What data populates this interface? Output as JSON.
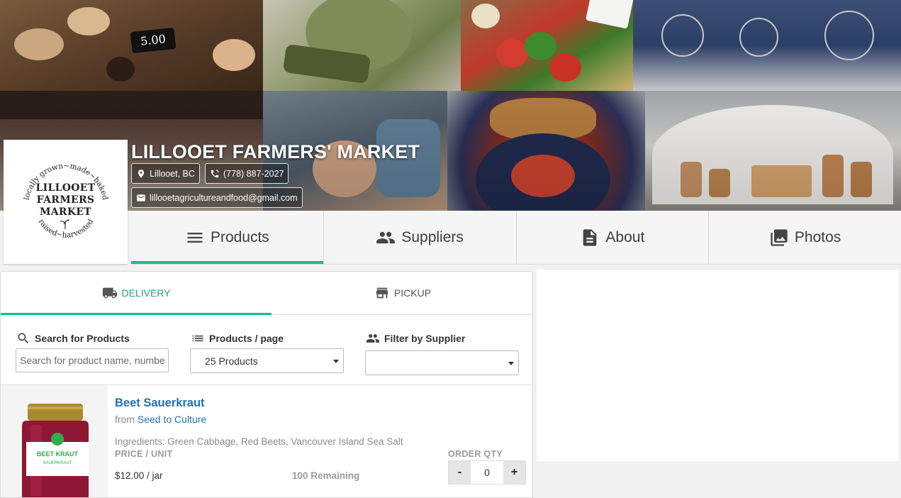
{
  "market": {
    "name": "LILLOOET FARMERS' MARKET",
    "location": "Lillooet, BC",
    "phone": "(778) 887-2027",
    "email": "lillooetagricultureandfood@gmail.com",
    "logo": {
      "center_lines": [
        "LILLOOET",
        "FARMERS",
        "MARKET"
      ],
      "ring_top": "locally grown~made~baked",
      "ring_bottom": "raised~harvested"
    },
    "hero_price_tag": "5.00"
  },
  "nav_tabs": [
    {
      "label": "Products",
      "icon": "menu-lines-icon",
      "active": true
    },
    {
      "label": "Suppliers",
      "icon": "people-icon",
      "active": false
    },
    {
      "label": "About",
      "icon": "document-icon",
      "active": false
    },
    {
      "label": "Photos",
      "icon": "photo-library-icon",
      "active": false
    }
  ],
  "mode_tabs": [
    {
      "label": "DELIVERY",
      "icon": "truck-icon",
      "active": true
    },
    {
      "label": "PICKUP",
      "icon": "store-icon",
      "active": false
    }
  ],
  "filters": {
    "search_label": "Search for Products",
    "search_placeholder": "Search for product name, number",
    "search_value": "",
    "per_page_label": "Products / page",
    "per_page_value": "25 Products",
    "supplier_label": "Filter by Supplier",
    "supplier_value": ""
  },
  "products": [
    {
      "name": "Beet Sauerkraut",
      "from_prefix": "from",
      "supplier": "Seed to Culture",
      "ingredients": "Ingredients: Green Cabbage, Red Beets, Vancouver Island Sea Salt",
      "price_label": "PRICE / UNIT",
      "price": "$12.00 / jar",
      "remaining": "100 Remaining",
      "qty_label": "ORDER QTY",
      "qty": "0",
      "minus": "-",
      "plus": "+",
      "jar_label": [
        "BEET KRAUT",
        "SAUERKRAUT"
      ]
    }
  ],
  "colors": {
    "accent": "#1abc8c",
    "link": "#1f6fb5"
  }
}
